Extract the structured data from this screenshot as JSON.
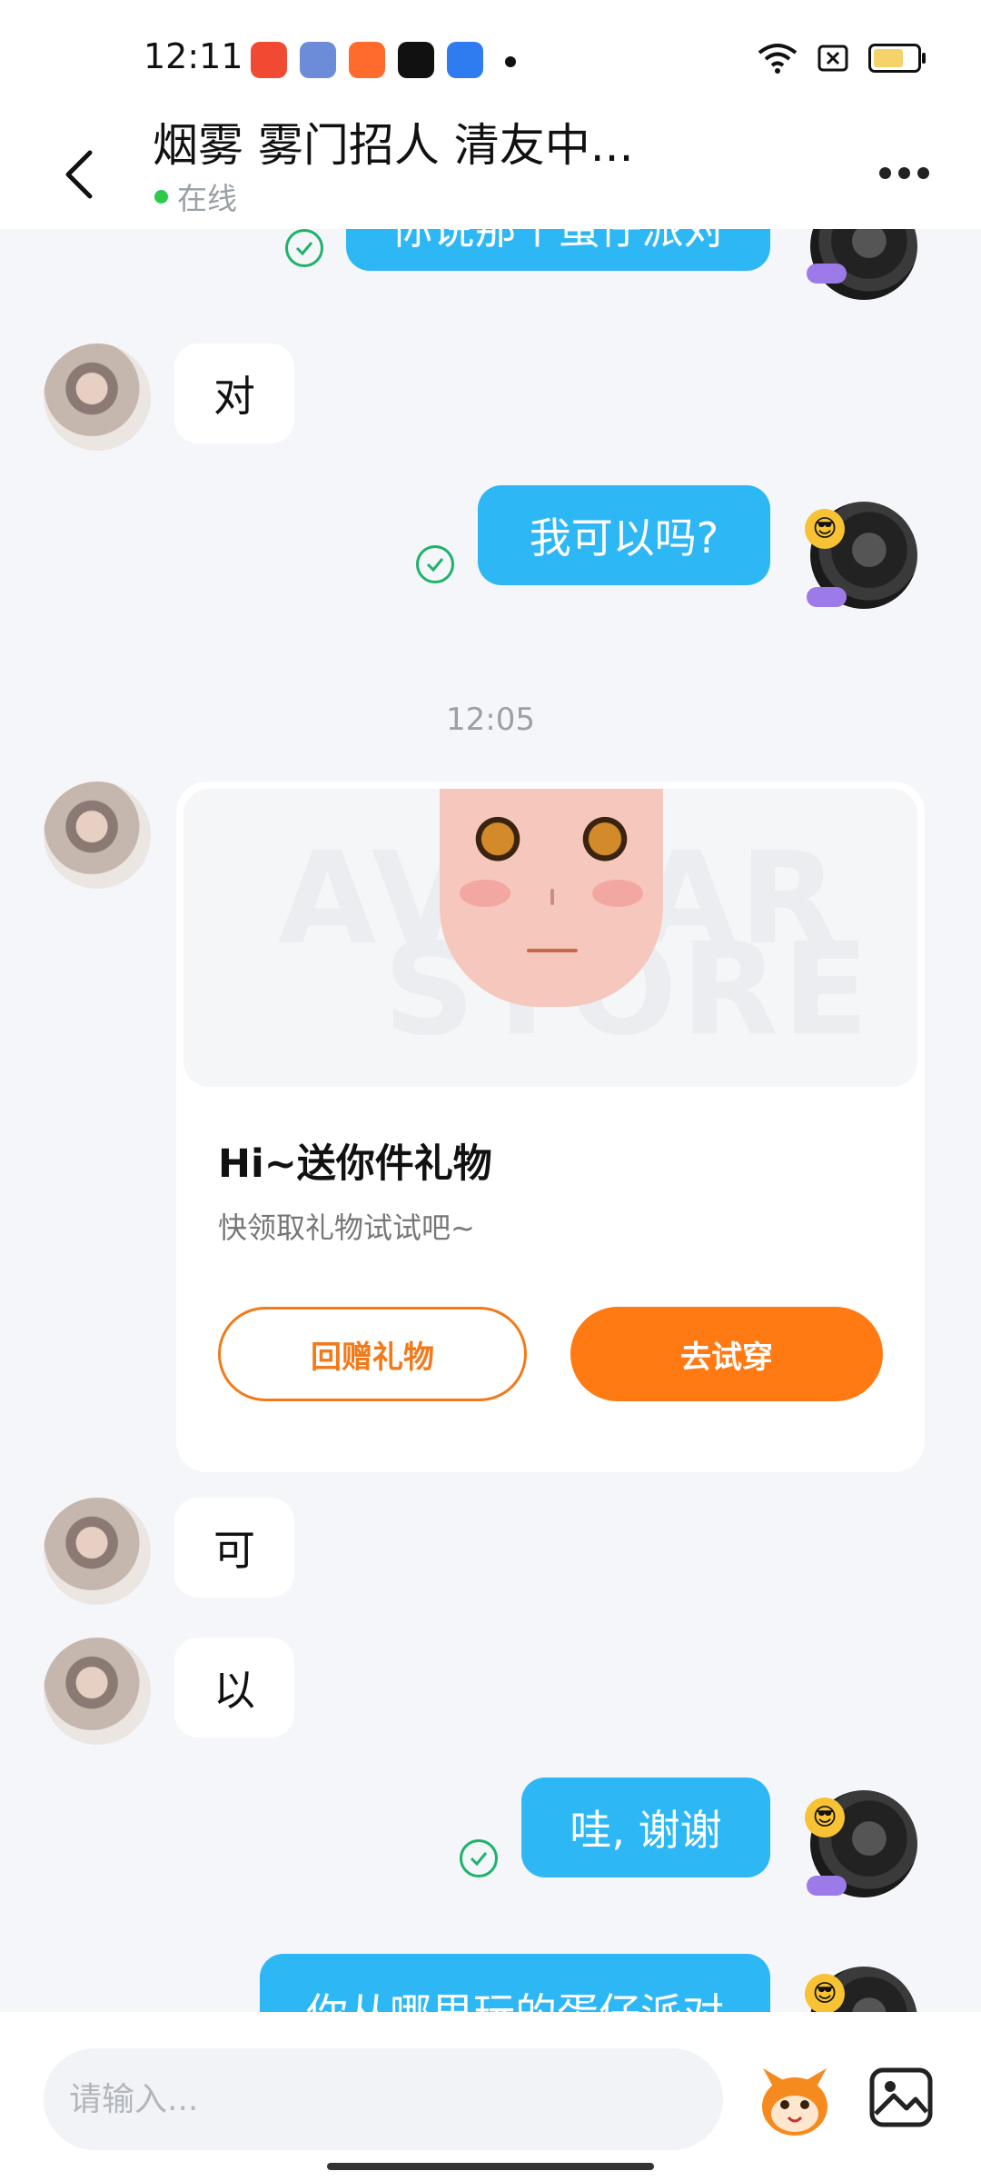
{
  "status_bar": {
    "time": "12:11",
    "apps": [
      {
        "icon": "video-app-icon",
        "color": "#F04A33"
      },
      {
        "icon": "game-app-icon",
        "color": "#6C8BD8"
      },
      {
        "icon": "kuaishou-app-icon",
        "color": "#FF6A2D"
      },
      {
        "icon": "tiktok-app-icon",
        "color": "#111111"
      },
      {
        "icon": "blue-app-icon",
        "color": "#2F7BF0"
      }
    ],
    "icons": [
      "wifi-icon",
      "sim-icon",
      "battery-icon"
    ]
  },
  "header": {
    "title": "烟雾 雾门招人 清友中...",
    "status": "在线"
  },
  "messages": {
    "m1_partial": "你说那个蛋仔派对",
    "m2": "对",
    "m3": "我可以吗?",
    "time_separator": "12:05",
    "m5": "可",
    "m6": "以",
    "m7": "哇, 谢谢",
    "m8_partial": "你从哪里玩的蛋仔派对"
  },
  "gift_card": {
    "watermark_line1": "AVATAR",
    "watermark_line2": "STORE",
    "title": "Hi~送你件礼物",
    "subtitle": "快领取礼物试试吧~",
    "return_gift_label": "回赠礼物",
    "try_on_label": "去试穿"
  },
  "composer": {
    "placeholder": "请输入..."
  },
  "colors": {
    "accent_blue": "#2EB7F5",
    "accent_orange": "#FF7A12",
    "online_green": "#2DC94A",
    "check_green": "#1FB26A"
  }
}
